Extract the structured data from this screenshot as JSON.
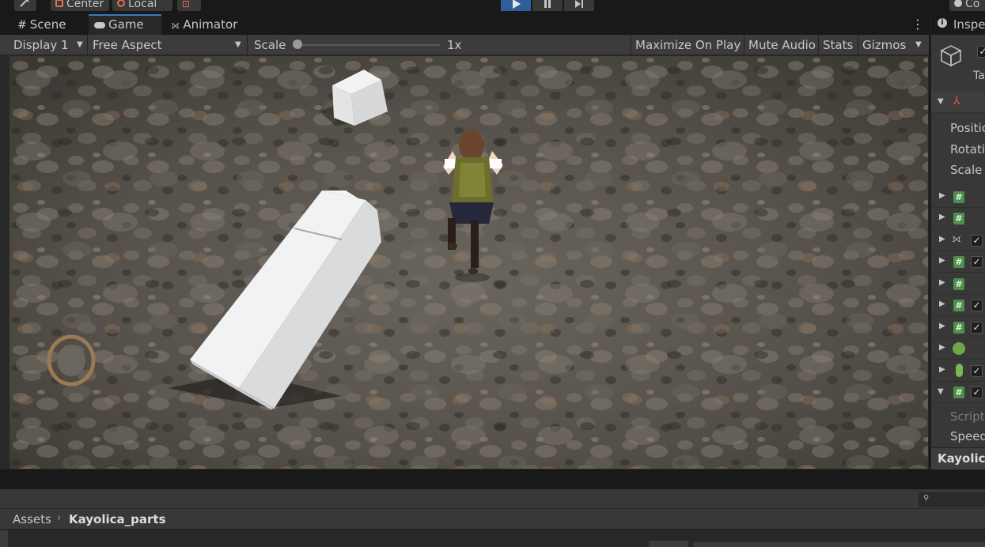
{
  "toolbar": {
    "pivot_label": "Center",
    "space_label": "Local",
    "right_label": "Co"
  },
  "tabs": [
    {
      "label": "Scene",
      "icon": "grid-icon"
    },
    {
      "label": "Game",
      "icon": "gamepad-icon",
      "active": true
    },
    {
      "label": "Animator",
      "icon": "animator-icon"
    }
  ],
  "game_bar": {
    "display": "Display 1",
    "aspect": "Free Aspect",
    "scale_label": "Scale",
    "scale_value": "1x",
    "maximize": "Maximize On Play",
    "mute": "Mute Audio",
    "stats": "Stats",
    "gizmos": "Gizmos"
  },
  "inspector": {
    "title": "Inspe",
    "tag_label": "Ta",
    "fields": [
      "Positic",
      "Rotatio",
      "Scale"
    ],
    "script_label": "Script",
    "speed_label": "Speed",
    "footer": "Kayolica"
  },
  "project": {
    "breadcrumb_root": "Assets",
    "breadcrumb_current": "Kayolica_parts"
  },
  "colors": {
    "accent": "#3a79bb",
    "play_active": "#2f5f9a",
    "panel": "#383838",
    "component_icon": "#4d8f4d"
  }
}
